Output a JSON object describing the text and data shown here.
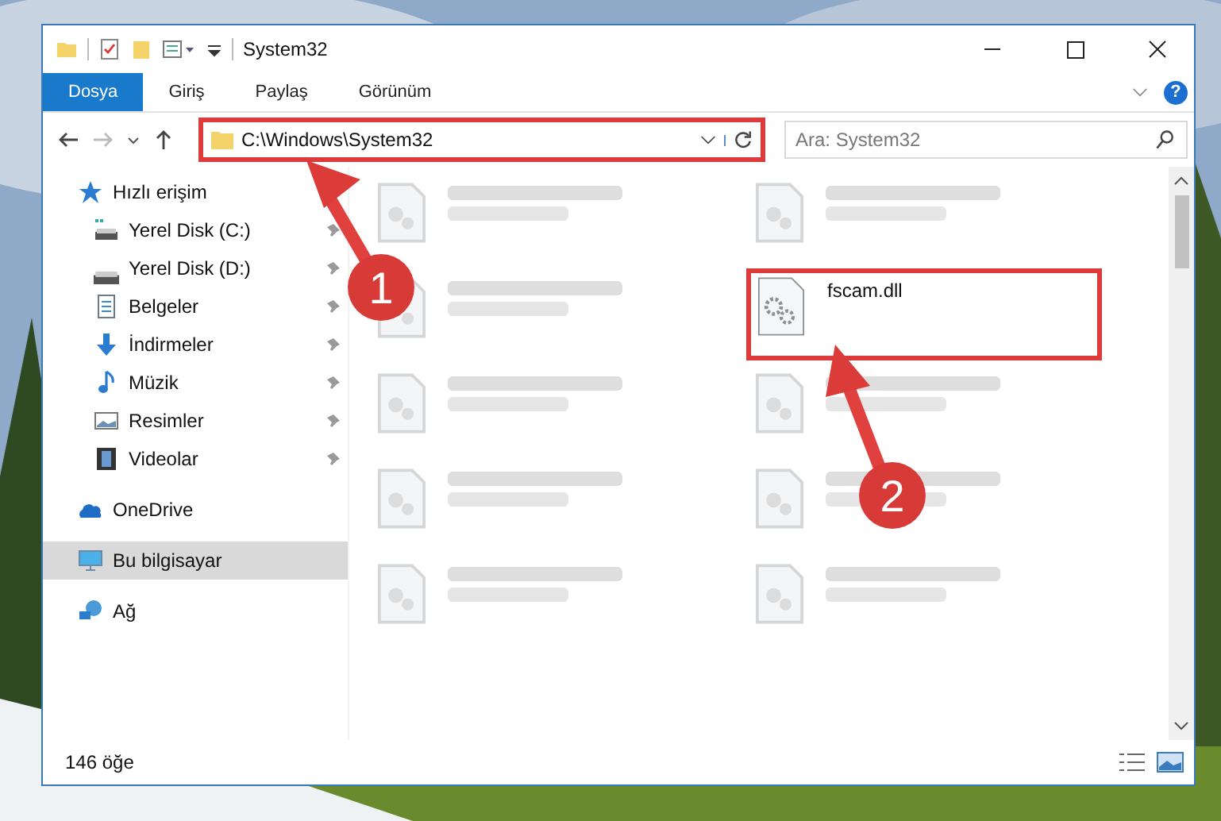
{
  "window": {
    "title": "System32"
  },
  "ribbon_tabs": [
    {
      "label": "Dosya",
      "selected": true
    },
    {
      "label": "Giriş",
      "selected": false
    },
    {
      "label": "Paylaş",
      "selected": false
    },
    {
      "label": "Görünüm",
      "selected": false
    }
  ],
  "help": "?",
  "address": {
    "path": "C:\\Windows\\System32",
    "highlighted": true
  },
  "search": {
    "placeholder": "Ara: System32"
  },
  "sidebar": {
    "items": [
      {
        "label": "Hızlı erişim",
        "kind": "quick",
        "selected": false,
        "children": [
          {
            "label": "Yerel Disk (C:)",
            "kind": "diskc",
            "pinned": true,
            "selected": false
          },
          {
            "label": "Yerel Disk (D:)",
            "kind": "disk",
            "pinned": true,
            "selected": false
          },
          {
            "label": "Belgeler",
            "kind": "docs",
            "pinned": true,
            "selected": false
          },
          {
            "label": "İndirmeler",
            "kind": "down",
            "pinned": true,
            "selected": false
          },
          {
            "label": "Müzik",
            "kind": "music",
            "pinned": true,
            "selected": false
          },
          {
            "label": "Resimler",
            "kind": "pics",
            "pinned": true,
            "selected": false
          },
          {
            "label": "Videolar",
            "kind": "video",
            "pinned": true,
            "selected": false
          }
        ]
      },
      {
        "label": "OneDrive",
        "kind": "cloud",
        "selected": false
      },
      {
        "label": "Bu bilgisayar",
        "kind": "pc",
        "selected": true
      },
      {
        "label": "Ağ",
        "kind": "net",
        "selected": false
      }
    ]
  },
  "files": [
    {
      "kind": "blurred"
    },
    {
      "kind": "blurred"
    },
    {
      "kind": "blurred"
    },
    {
      "kind": "file",
      "name": "fscam.dll",
      "highlighted": true
    },
    {
      "kind": "blurred"
    },
    {
      "kind": "blurred"
    },
    {
      "kind": "blurred"
    },
    {
      "kind": "blurred"
    },
    {
      "kind": "blurred"
    },
    {
      "kind": "blurred"
    }
  ],
  "status_bar": {
    "count": "146 öğe"
  },
  "callouts": [
    {
      "number": "1"
    },
    {
      "number": "2"
    }
  ]
}
